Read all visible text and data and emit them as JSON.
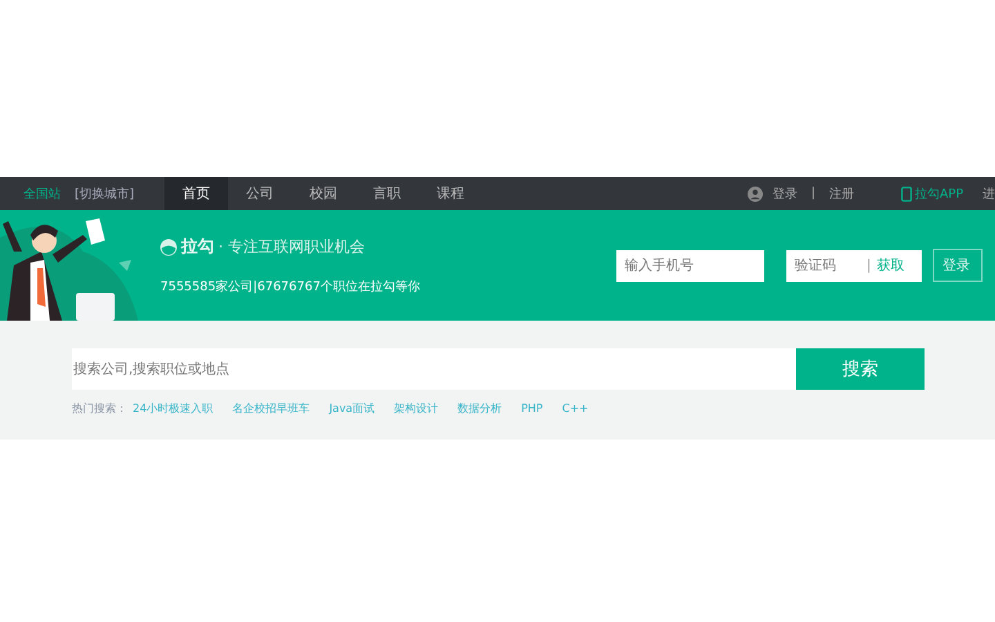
{
  "top_nav": {
    "site": "全国站",
    "switch_city": "[切换城市]",
    "tabs": [
      {
        "label": "首页",
        "selected": true
      },
      {
        "label": "公司",
        "selected": false
      },
      {
        "label": "校园",
        "selected": false
      },
      {
        "label": "言职",
        "selected": false
      },
      {
        "label": "课程",
        "selected": false
      }
    ],
    "login": "登录",
    "separator": "|",
    "register": "注册",
    "app": "拉勾APP",
    "more": "进"
  },
  "banner": {
    "logo": "拉勾",
    "tagline": "· 专注互联网职业机会",
    "stats": "7555585家公司|67676767个职位在拉勾等你",
    "phone_field": {
      "placeholder": "输入手机号"
    },
    "code_field": {
      "placeholder": "验证码"
    },
    "code_separator": "|",
    "get_code": "获取",
    "login_button": "登录"
  },
  "search": {
    "placeholder": "搜索公司,搜索职位或地点",
    "button": "搜索",
    "hot_label": "热门搜索：",
    "hot_items": [
      "24小时极速入职",
      "名企校招早班车",
      "Java面试",
      "架构设计",
      "数据分析",
      "PHP",
      "C++"
    ]
  }
}
